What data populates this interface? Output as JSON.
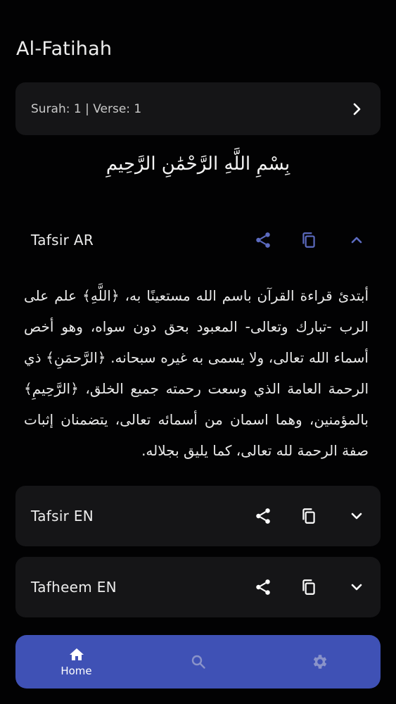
{
  "header": {
    "title": "Al-Fatihah"
  },
  "verse_selector": {
    "label": "Surah: 1 | Verse: 1"
  },
  "bismillah": "بِسْمِ اللَّهِ الرَّحْمَٰنِ الرَّحِيمِ",
  "sections": [
    {
      "title": "Tafsir AR",
      "expanded": true,
      "body": "أبتدئ قراءة القرآن باسم الله مستعينًا به، ﴿اللَّهِ﴾ علم على الرب -تبارك وتعالى- المعبود بحق دون سواه، وهو أخص أسماء الله تعالى، ولا يسمى به غيره سبحانه. ﴿الرَّحمَنِ﴾ ذي الرحمة العامة الذي وسعت رحمته جميع الخلق، ﴿الرَّحِيمِ﴾ بالمؤمنين، وهما اسمان من أسمائه تعالى، يتضمنان إثبات صفة الرحمة لله تعالى، كما يليق بجلاله."
    },
    {
      "title": "Tafsir EN",
      "expanded": false
    },
    {
      "title": "Tafheem EN",
      "expanded": false
    }
  ],
  "bottom_nav": {
    "items": [
      {
        "label": "Home",
        "icon": "home-icon",
        "active": true
      },
      {
        "label": "",
        "icon": "search-icon",
        "active": false
      },
      {
        "label": "",
        "icon": "settings-gear-icon",
        "active": false
      }
    ]
  },
  "colors": {
    "background": "#020203",
    "card": "#151517",
    "accent": "#5c6bc0",
    "nav_bar": "#3f51b5",
    "inactive_nav_icon": "#8a93c9"
  }
}
